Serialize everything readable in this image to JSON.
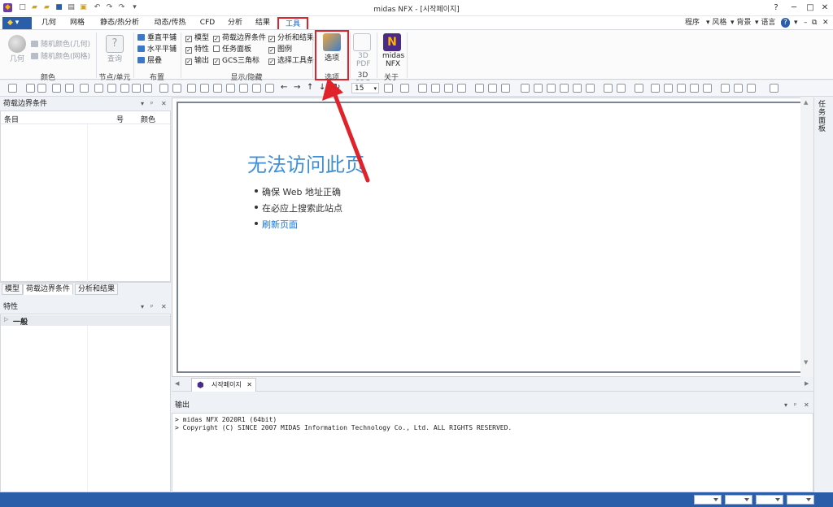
{
  "window": {
    "title": "midas NFX - [시작페이지]"
  },
  "app_menu_label": "▾",
  "ribbon_tabs": [
    {
      "label": "几何"
    },
    {
      "label": "网格"
    },
    {
      "label": "静态/热分析"
    },
    {
      "label": "动态/传热"
    },
    {
      "label": "CFD"
    },
    {
      "label": "分析"
    },
    {
      "label": "结果"
    },
    {
      "label": "工具"
    }
  ],
  "right_tools": {
    "program": "程序",
    "style": "风格",
    "background": "背景",
    "language": "语言",
    "help": "?"
  },
  "ribbon": {
    "color_group": {
      "label": "颜色",
      "geometry_btn": "几何",
      "random_geom": "随机颜色(几何)",
      "random_mesh": "随机颜色(网格)"
    },
    "node_group": {
      "label": "节点/单元",
      "query_btn": "查询"
    },
    "layout_group": {
      "label": "布置",
      "vertical": "垂直平铺",
      "horizontal": "水平平铺",
      "cascade": "层叠"
    },
    "display_group": {
      "label": "显示/隐藏",
      "items": [
        "模型",
        "荷载边界条件",
        "分析和结果",
        "特性",
        "任务面板",
        "图例",
        "输出",
        "GCS三角标",
        "选择工具条"
      ]
    },
    "options_group": {
      "label": "选项",
      "options_btn": "选项"
    },
    "pdf_group": {
      "label": "3D PDF",
      "pdf_btn_line1": "3D",
      "pdf_btn_line2": "PDF"
    },
    "about_group": {
      "label": "关于",
      "about_line1": "midas",
      "about_line2": "NFX"
    }
  },
  "toolbar": {
    "zoom_value": "15"
  },
  "left_panel": {
    "lbc_title": "荷载边界条件",
    "columns": [
      "条目",
      "号",
      "颜色"
    ],
    "tabs": [
      "模型",
      "荷载边界条件",
      "分析和结果"
    ],
    "props_title": "特性",
    "props_section": "一般"
  },
  "doc": {
    "error_title": "无法访问此页",
    "bullets": [
      "确保 Web 地址正确",
      "在必应上搜索此站点"
    ],
    "refresh_link": "刷新页面",
    "tab_label": "시작페이지"
  },
  "right_strip_label": "任务面板",
  "output": {
    "title": "输出",
    "lines": [
      "> midas NFX 2020R1 (64bit)",
      "> Copyright (C) SINCE 2007 MIDAS Information Technology Co., Ltd. ALL RIGHTS RESERVED."
    ]
  },
  "colors": {
    "accent_blue": "#2b5ea8",
    "highlight_red": "#e0232b",
    "error_title_blue": "#3d8fd6"
  }
}
